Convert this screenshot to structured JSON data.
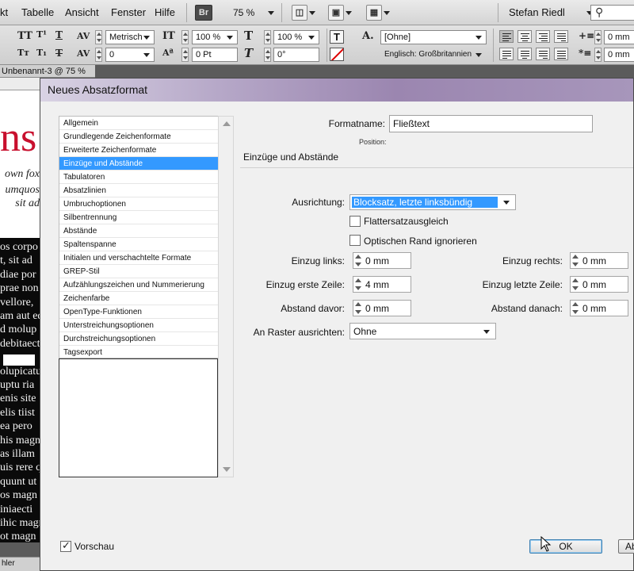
{
  "menubar": {
    "items": [
      "kt",
      "Tabelle",
      "Ansicht",
      "Fenster",
      "Hilfe"
    ],
    "bridge_label": "Br",
    "zoom": "75 %",
    "user": "Stefan Riedl"
  },
  "controlbar": {
    "kerning_method": "Metrisch",
    "tracking": "0",
    "vertical_scale": "100 %",
    "horizontal_scale": "100 %",
    "baseline_shift": "0 Pt",
    "skew": "0°",
    "char_style": "[Ohne]",
    "language": "Englisch: Großbritannien",
    "indent_left": "0 mm",
    "indent_first": "0 mm"
  },
  "document": {
    "tab_title": "Unbenannt-3 @ 75 %",
    "big_text": "ns O",
    "header_lines": [
      "own fox",
      "umquos",
      "sit ad"
    ],
    "body_lines": [
      "os corpo",
      "t, sit ad",
      "diae por",
      "prae non",
      "vellore,",
      "am aut ed",
      "d molup",
      "debitaect",
      "",
      "olupicatu",
      "uptu ria",
      "enis site",
      "elis tiist",
      "ea pero",
      "his magn",
      "as illam",
      "uis rere q",
      "quunt ut",
      "os magn",
      "iniaecti",
      "ihic magn",
      "ot magn"
    ],
    "status": "hler"
  },
  "dialog": {
    "title": "Neues Absatzformat",
    "categories": [
      "Allgemein",
      "Grundlegende Zeichenformate",
      "Erweiterte Zeichenformate",
      "Einzüge und Abstände",
      "Tabulatoren",
      "Absatzlinien",
      "Umbruchoptionen",
      "Silbentrennung",
      "Abstände",
      "Spaltenspanne",
      "Initialen und verschachtelte Formate",
      "GREP-Stil",
      "Aufzählungszeichen und Nummerierung",
      "Zeichenfarbe",
      "OpenType-Funktionen",
      "Unterstreichungsoptionen",
      "Durchstreichungsoptionen",
      "Tagsexport"
    ],
    "selected_category": "Einzüge und Abstände",
    "format_name_label": "Formatname:",
    "format_name_value": "Fließtext",
    "position_label": "Position:",
    "section_title": "Einzüge und Abstände",
    "alignment_label": "Ausrichtung:",
    "alignment_value": "Blocksatz, letzte linksbündig",
    "flattersatz_label": "Flattersatzausgleich",
    "optical_margin_label": "Optischen Rand ignorieren",
    "indent_left_label": "Einzug links:",
    "indent_left_value": "0 mm",
    "indent_right_label": "Einzug rechts:",
    "indent_right_value": "0 mm",
    "indent_first_label": "Einzug erste Zeile:",
    "indent_first_value": "4 mm",
    "indent_last_label": "Einzug letzte Zeile:",
    "indent_last_value": "0 mm",
    "space_before_label": "Abstand davor:",
    "space_before_value": "0 mm",
    "space_after_label": "Abstand danach:",
    "space_after_value": "0 mm",
    "grid_label": "An Raster ausrichten:",
    "grid_value": "Ohne",
    "preview_label": "Vorschau",
    "preview_checked": true,
    "ok_label": "OK",
    "cancel_label": "Ab"
  }
}
